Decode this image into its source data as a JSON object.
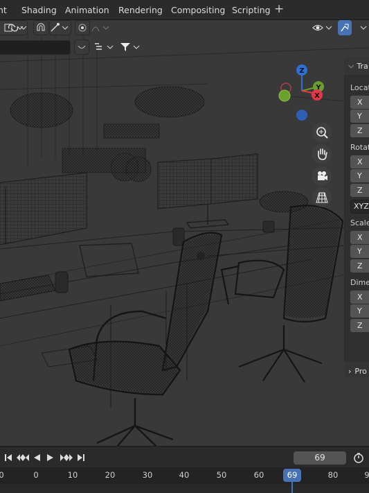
{
  "workspaces": [
    "nt",
    "Shading",
    "Animation",
    "Rendering",
    "Compositing",
    "Scripting"
  ],
  "add_workspace": "+",
  "colors": {
    "accent": "#4772b3",
    "axis_x": "#e5364a",
    "axis_y": "#6aa02c",
    "axis_z": "#2f70d6",
    "viewport_bg": "#393939"
  },
  "npanel": {
    "tab_label": "Tra",
    "collapsed_label": "Pro",
    "location_label": "Locat",
    "rotation_label": "Rotat",
    "rotation_mode": "XYZ",
    "scale_label": "Scale",
    "dimensions_label": "Dime",
    "axes": [
      "X",
      "Y",
      "Z"
    ]
  },
  "gizmo": {
    "x": "X",
    "y": "Y",
    "z": "Z"
  },
  "timeline": {
    "current_frame": "69",
    "ruler_labels": [
      "0",
      "0",
      "10",
      "20",
      "30",
      "40",
      "50",
      "60",
      "69",
      "80",
      "9"
    ]
  },
  "icons": {
    "header_left": [
      "select-mode-icon",
      "link-icon",
      "snap-magnet-icon",
      "snap-target-icon",
      "proportional-edit-icon",
      "falloff-curve-icon"
    ],
    "header_right": [
      "visibility-eye-icon",
      "gizmo-toggle-icon"
    ],
    "nav": [
      "zoom-icon",
      "pan-hand-icon",
      "camera-icon",
      "ortho-grid-icon"
    ],
    "playback": [
      "jump-start-icon",
      "prev-keyframe-icon",
      "play-reverse-icon",
      "play-icon",
      "next-keyframe-icon",
      "jump-end-icon"
    ]
  }
}
